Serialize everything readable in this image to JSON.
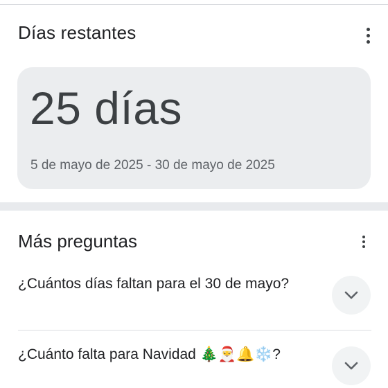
{
  "card": {
    "title": "Días restantes",
    "menu_icon": "more-vert-icon",
    "result_value": "25 días",
    "date_range": "5 de mayo de 2025 - 30 de mayo de 2025"
  },
  "more_questions": {
    "title": "Más preguntas",
    "menu_icon": "more-vert-icon",
    "items": [
      {
        "question": "¿Cuántos días faltan para el 30 de mayo?",
        "icon": "chevron-down-icon"
      },
      {
        "question": "¿Cuánto falta para Navidad 🎄🎅🔔❄️?",
        "icon": "chevron-down-icon"
      }
    ]
  },
  "colors": {
    "text_primary": "#202124",
    "text_secondary": "#5f6368",
    "result_bg": "#ebedef",
    "expand_bg": "#f1f3f4",
    "divider": "#dadce0"
  }
}
